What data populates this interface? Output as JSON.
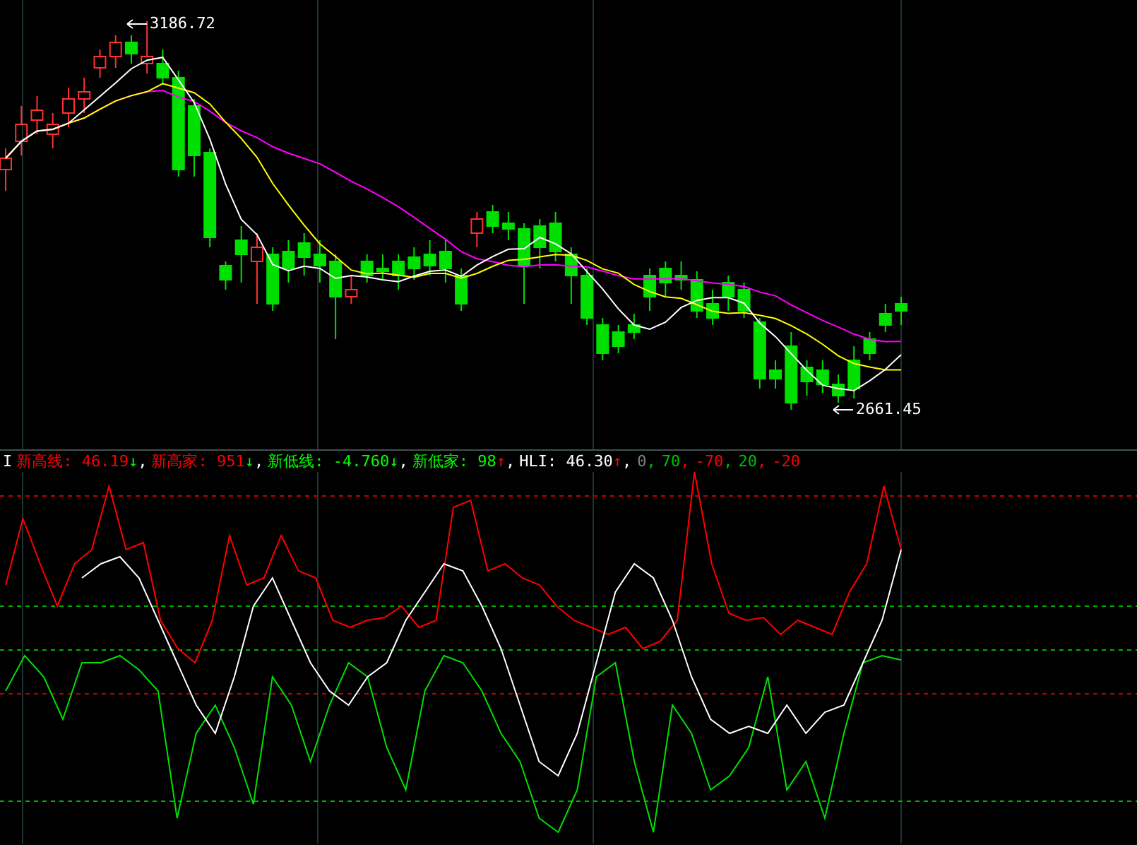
{
  "price_chart": {
    "high_label": "3186.72",
    "low_label": "2661.45"
  },
  "indicator_legend": {
    "indicator_name": "I",
    "separator": ",",
    "items": [
      {
        "label": "新高线: 46.19",
        "arrow": {
          "text": "↓",
          "color": "#00ff00"
        },
        "color": "#ff0000"
      },
      {
        "label": "新高家: 951",
        "arrow": {
          "text": "↓",
          "color": "#00ff00"
        },
        "color": "#ff0000"
      },
      {
        "label": "新低线: -4.760",
        "arrow": {
          "text": "↓",
          "color": "#00ff00"
        },
        "color": "#00ff00"
      },
      {
        "label": "新低家: 98",
        "arrow": {
          "text": "↑",
          "color": "#ff0000"
        },
        "color": "#00ff00"
      },
      {
        "label": "HLI: 46.30",
        "arrow": {
          "text": "↑",
          "color": "#ff0000"
        },
        "color": "#ffffff"
      }
    ],
    "levels": [
      {
        "label": "0",
        "color": "#808080"
      },
      {
        "label": "70",
        "color": "#00c000"
      },
      {
        "label": "-70",
        "color": "#ff0000"
      },
      {
        "label": "20",
        "color": "#00c000"
      },
      {
        "label": "-20",
        "color": "#ff0000"
      }
    ]
  }
}
